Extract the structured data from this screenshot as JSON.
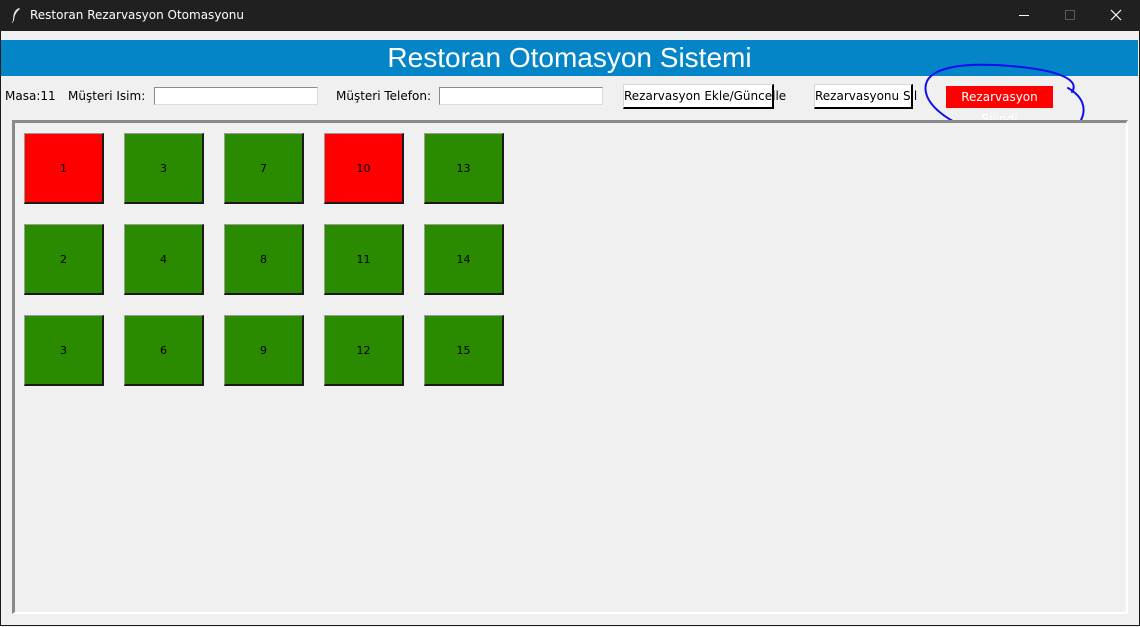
{
  "window": {
    "title": "Restoran Rezarvasyon Otomasyonu"
  },
  "header": {
    "title": "Restoran Otomasyon Sistemi"
  },
  "form": {
    "table_label": "Masa:11",
    "customer_name_label": "Müşteri Isim:",
    "customer_name_value": "",
    "customer_phone_label": "Müşteri Telefon:",
    "customer_phone_value": "",
    "add_update_button": "Rezarvasyon Ekle/Güncelle",
    "delete_button": "Rezarvasyonu Sil",
    "status_message": "Rezarvasyon Silindi"
  },
  "colors": {
    "header": "#0385c7",
    "reserved": "#ff0000",
    "available": "#2a8b00",
    "status_bg": "#ff0000",
    "annotation": "#1010ee"
  },
  "tables": [
    {
      "label": "1",
      "status": "reserved"
    },
    {
      "label": "3",
      "status": "available"
    },
    {
      "label": "7",
      "status": "available"
    },
    {
      "label": "10",
      "status": "reserved"
    },
    {
      "label": "13",
      "status": "available"
    },
    {
      "label": "2",
      "status": "available"
    },
    {
      "label": "4",
      "status": "available"
    },
    {
      "label": "8",
      "status": "available"
    },
    {
      "label": "11",
      "status": "available"
    },
    {
      "label": "14",
      "status": "available"
    },
    {
      "label": "3",
      "status": "available"
    },
    {
      "label": "6",
      "status": "available"
    },
    {
      "label": "9",
      "status": "available"
    },
    {
      "label": "12",
      "status": "available"
    },
    {
      "label": "15",
      "status": "available"
    }
  ]
}
